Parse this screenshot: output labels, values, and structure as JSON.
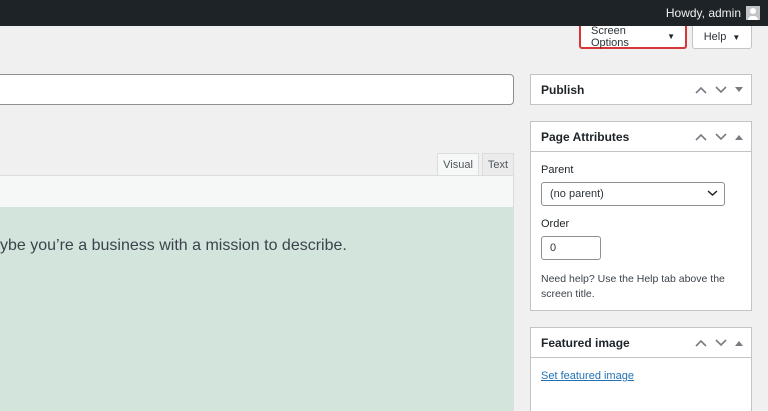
{
  "admin_bar": {
    "greeting": "Howdy, admin"
  },
  "screen_meta": {
    "screen_options": "Screen Options",
    "help": "Help"
  },
  "editor": {
    "tabs": [
      {
        "label": "Visual"
      },
      {
        "label": "Text"
      }
    ],
    "content_text": "ybe you’re a business with a mission to describe."
  },
  "sidebar": {
    "publish": {
      "title": "Publish"
    },
    "page_attributes": {
      "title": "Page Attributes",
      "parent_label": "Parent",
      "parent_value": "(no parent)",
      "order_label": "Order",
      "order_value": "0",
      "help_text": "Need help? Use the Help tab above the screen title."
    },
    "featured_image": {
      "title": "Featured image",
      "link": "Set featured image"
    }
  },
  "colors": {
    "admin_bar": "#1d2327",
    "highlight": "#d63638",
    "link": "#2271b1",
    "content_bg": "#d3e4dd"
  }
}
